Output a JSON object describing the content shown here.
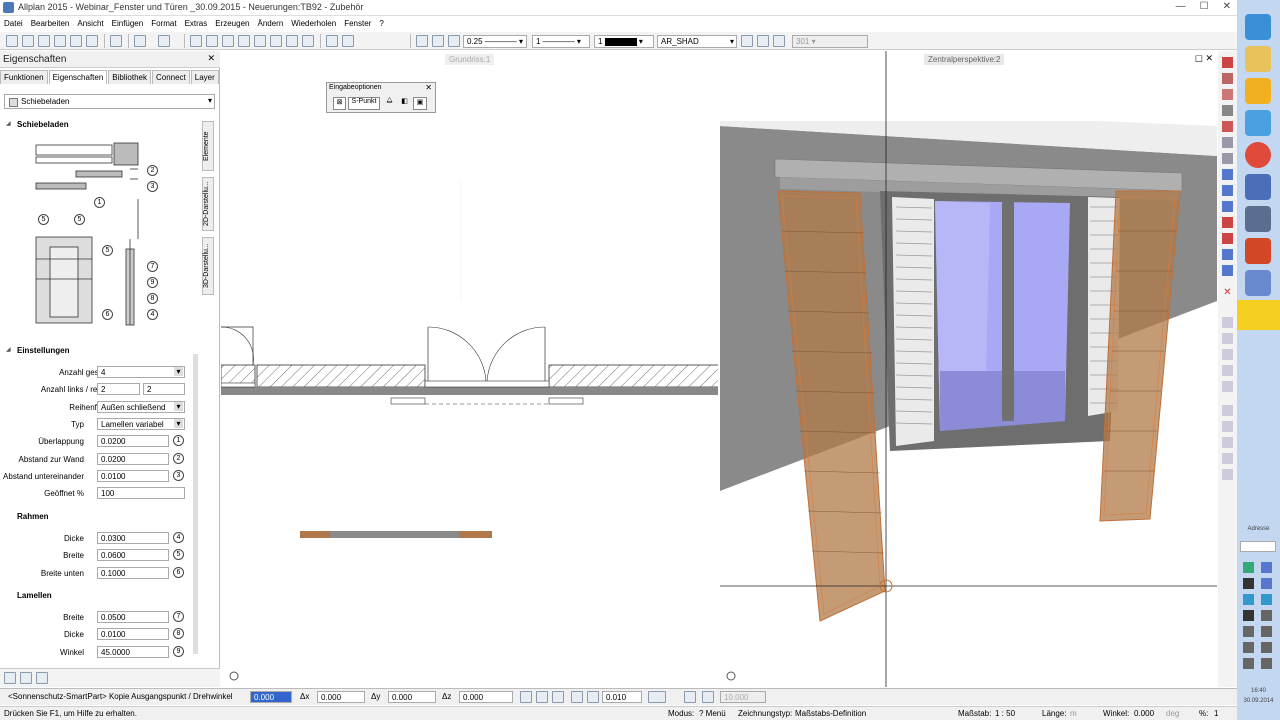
{
  "window": {
    "title": "Allplan 2015 - Webinar_Fenster und Türen _30.09.2015 - Neuerungen:TB92 - Zubehör",
    "min": "—",
    "max": "☐",
    "close": "✕"
  },
  "menu": [
    "Datei",
    "Bearbeiten",
    "Ansicht",
    "Einfügen",
    "Format",
    "Extras",
    "Erzeugen",
    "Ändern",
    "Wiederholen",
    "Fenster",
    "?"
  ],
  "toolbar": {
    "pen": "0.25",
    "line": "1",
    "color": "1",
    "layer": "AR_SHAD",
    "layer2": "301"
  },
  "panel": {
    "title": "Eigenschaften",
    "close": "✕",
    "tabs": [
      "Funktionen",
      "Eigenschaften",
      "Bibliothek",
      "Connect",
      "Layer"
    ],
    "element": "Schiebeladen",
    "vtabs": [
      "Elemente",
      "2D-Darstellu...",
      "3D-Darstellu..."
    ],
    "diagram_numbers": [
      "1",
      "2",
      "3",
      "4",
      "5",
      "5",
      "5",
      "6",
      "7",
      "8",
      "9"
    ],
    "sections": {
      "s1": "Schiebeladen",
      "s2": "Einstellungen",
      "s3": "Rahmen",
      "s4": "Lamellen"
    },
    "einstellungen": [
      {
        "label": "Anzahl gesamt",
        "value": "4"
      },
      {
        "label": "Anzahl links / rechts",
        "value": "2",
        "value2": "2"
      },
      {
        "label": "Reihenfolge",
        "value": "Außen schließend"
      },
      {
        "label": "Typ",
        "value": "Lamellen variabel"
      },
      {
        "label": "Überlappung",
        "value": "0.0200",
        "num": "1"
      },
      {
        "label": "Abstand zur Wand",
        "value": "0.0200",
        "num": "2"
      },
      {
        "label": "Abstand untereinander",
        "value": "0.0100",
        "num": "3"
      },
      {
        "label": "Geöffnet %",
        "value": "100"
      }
    ],
    "rahmen": [
      {
        "label": "Dicke",
        "value": "0.0300",
        "num": "4"
      },
      {
        "label": "Breite",
        "value": "0.0600",
        "num": "5"
      },
      {
        "label": "Breite unten",
        "value": "0.1000",
        "num": "6"
      }
    ],
    "lamellen": [
      {
        "label": "Breite",
        "value": "0.0500",
        "num": "7"
      },
      {
        "label": "Dicke",
        "value": "0.0100",
        "num": "8"
      },
      {
        "label": "Winkel",
        "value": "45.0000",
        "num": "9"
      }
    ]
  },
  "view2d": {
    "title": "Grundriss:1"
  },
  "eingabe": {
    "title": "Eingabeoptionen",
    "close": "✕",
    "spunkt": "S-Punkt"
  },
  "view3d": {
    "title": "Zentralperspektive:2"
  },
  "cmdbar": {
    "prompt": "<Sonnenschutz-SmartPart> Kopie Ausgangspunkt / Drehwinkel",
    "input": "0.000",
    "dx_label": "Δx",
    "dx": "0.000",
    "dy_label": "Δy",
    "dy": "0.000",
    "dz_label": "Δz",
    "dz": "0.000",
    "snap": "0.010",
    "grid": "10.000"
  },
  "status": {
    "hint": "Drücken Sie F1, um Hilfe zu erhalten.",
    "modus": "Modus:",
    "modus_val": "? Menü",
    "zeichnungstyp": "Zeichnungstyp:",
    "zeichnungstyp_val": "Maßstabs-Definition",
    "massstab": "Maßstab:",
    "massstab_val": "1 : 50",
    "laenge": "Länge:",
    "laenge_val": "m",
    "winkel": "Winkel:",
    "winkel_val": "0.000",
    "deg": "deg",
    "pct": "%:",
    "pct_val": "1"
  },
  "taskbar": {
    "adresse": "Adresse",
    "time": "16:40",
    "date": "30.09.2014"
  },
  "colors": {
    "accent": "#4a78b8",
    "shutter": "#c0703a",
    "wall": "#8a8a8a",
    "glass": "#9a9cf0"
  }
}
